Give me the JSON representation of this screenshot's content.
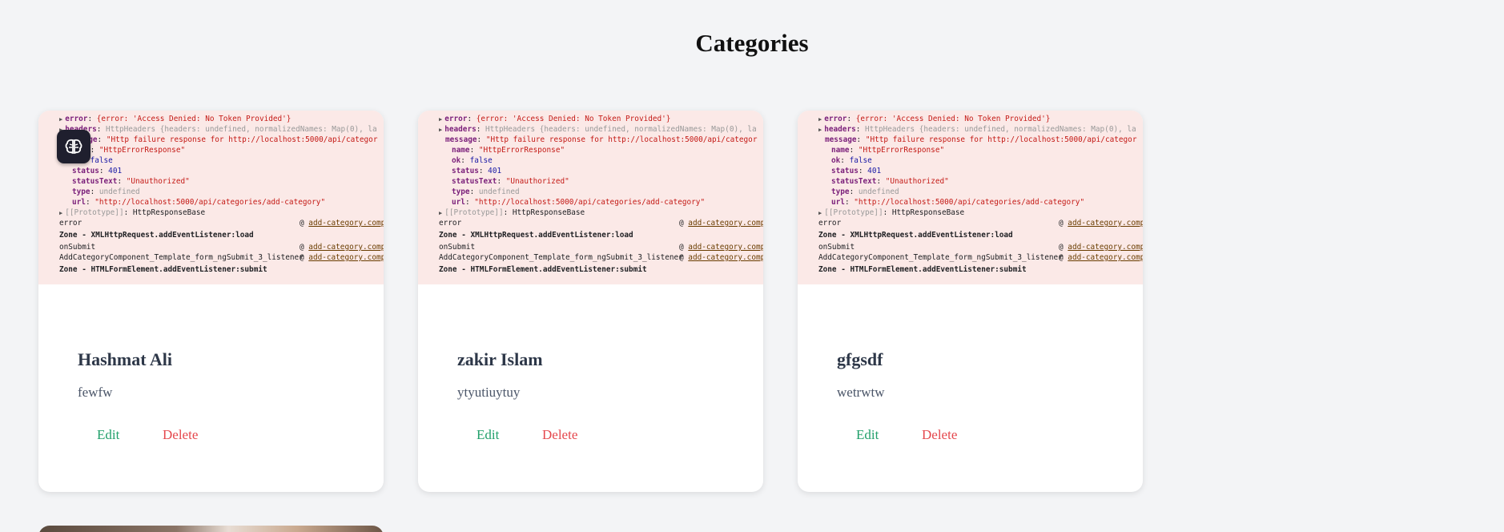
{
  "page": {
    "title": "Categories"
  },
  "floating_button": {
    "icon": "brain-icon"
  },
  "cards": [
    {
      "name": "Hashmat Ali",
      "description": "fewfw",
      "edit_label": "Edit",
      "delete_label": "Delete"
    },
    {
      "name": "zakir Islam",
      "description": "ytyutiuytuy",
      "edit_label": "Edit",
      "delete_label": "Delete"
    },
    {
      "name": "gfgsdf",
      "description": "wetrwtw",
      "edit_label": "Edit",
      "delete_label": "Delete"
    }
  ],
  "card_image_log": {
    "error_key": "error",
    "error_value": "{error: 'Access Denied: No Token Provided'}",
    "headers_key": "headers",
    "headers_value": "HttpHeaders {headers: undefined, normalizedNames: Map(0), la",
    "message_key": "message",
    "message_value": "\"Http failure response for http://localhost:5000/api/categor",
    "name_key": "name",
    "name_value": "\"HttpErrorResponse\"",
    "ok_key": "ok",
    "ok_value": "false",
    "status_key": "status",
    "status_value": "401",
    "statusText_key": "statusText",
    "statusText_value": "\"Unauthorized\"",
    "type_key": "type",
    "type_value": "undefined",
    "url_key": "url",
    "url_value": "\"http://localhost:5000/api/categories/add-category\"",
    "prototype_key": "[[Prototype]]",
    "prototype_value": "HttpResponseBase",
    "stack": [
      {
        "fn": "error",
        "src": "add-category.compon",
        "sep": false
      },
      {
        "fn": "Zone - XMLHttpRequest.addEventListener:load",
        "src": "",
        "sep": true
      },
      {
        "fn": "onSubmit",
        "src": "add-category.compon",
        "sep": false
      },
      {
        "fn": "AddCategoryComponent_Template_form_ngSubmit_3_listener",
        "src": "add-category.compon",
        "sep": false
      },
      {
        "fn": "Zone - HTMLFormElement.addEventListener:submit",
        "src": "",
        "sep": true
      }
    ]
  },
  "colors": {
    "background": "#f3f4f6",
    "card": "#ffffff",
    "log_bg": "#fbe9e7",
    "edit": "#22a06b",
    "delete": "#e5484d",
    "title": "#2d3748"
  }
}
